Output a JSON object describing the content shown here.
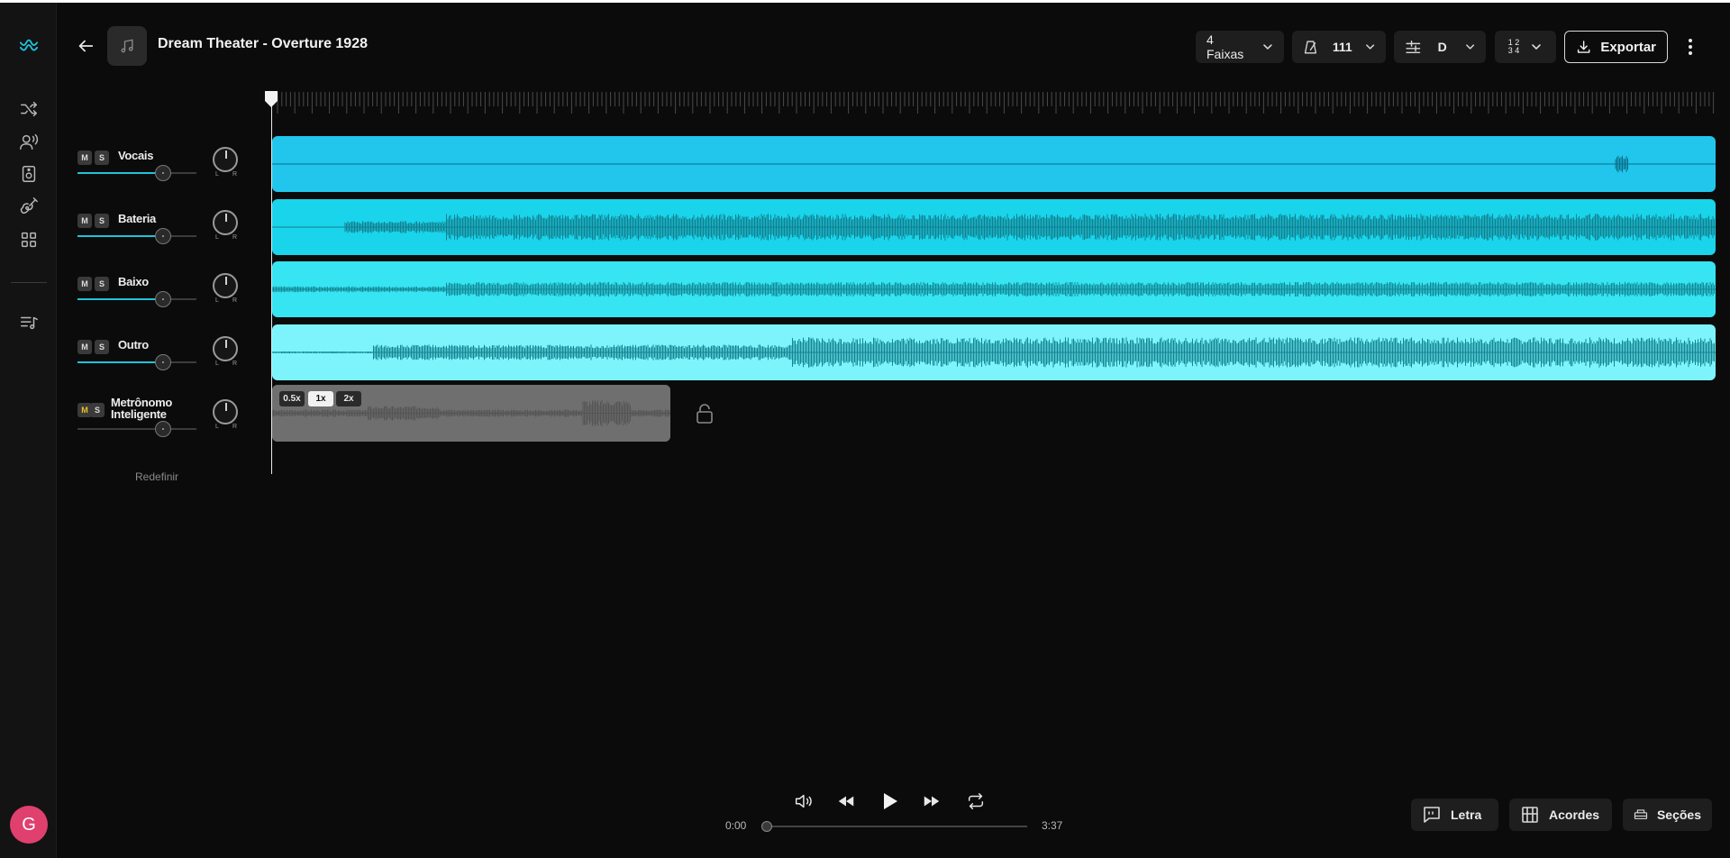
{
  "header": {
    "title": "Dream Theater - Overture 1928",
    "tracks_btn": "4 Faixas",
    "tempo": "111",
    "key": "D",
    "export": "Exportar"
  },
  "rail": {
    "icons": [
      "logo-icon",
      "shuffle-icon",
      "voice-icon",
      "speaker-icon",
      "guitar-icon",
      "apps-icon",
      "playlist-icon"
    ],
    "avatar_initial": "G"
  },
  "tracks": [
    {
      "name": "Vocais",
      "volume": 0.72,
      "color": "#22c6ec"
    },
    {
      "name": "Bateria",
      "volume": 0.72,
      "color": "#19d4ea"
    },
    {
      "name": "Baixo",
      "volume": 0.72,
      "color": "#36e4f2"
    },
    {
      "name": "Outro",
      "volume": 0.72,
      "color": "#7df4fb"
    },
    {
      "name": "Metrônomo\nInteligente",
      "volume": 0.72,
      "color": "#6f6f6f",
      "mute_active": true
    }
  ],
  "track_labels": {
    "mute": "M",
    "solo": "S",
    "pan_left": "L",
    "pan_right": "R"
  },
  "metronome": {
    "speeds": [
      "0.5x",
      "1x",
      "2x"
    ],
    "active_speed": "1x"
  },
  "reset_label": "Redefinir",
  "transport": {
    "current_time": "0:00",
    "total_time": "3:37",
    "progress": 0.0
  },
  "bottom_buttons": {
    "lyrics": "Letra",
    "chords": "Acordes",
    "sections": "Seções"
  },
  "colors": {
    "accent": "#20c3d9",
    "avatar": "#e0406e"
  }
}
